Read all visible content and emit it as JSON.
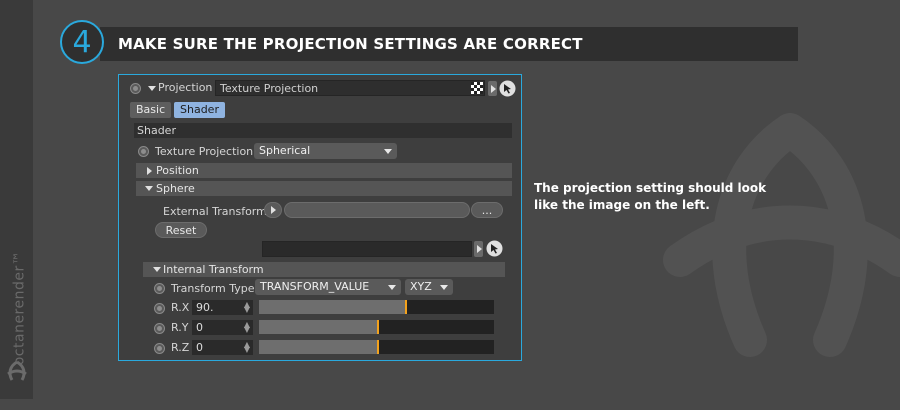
{
  "brand": {
    "name": "octanerender™"
  },
  "step": {
    "number": "4",
    "title": "MAKE SURE THE PROJECTION SETTINGS ARE CORRECT"
  },
  "description": "The projection setting should look like the image on the left.",
  "panel": {
    "projection": {
      "label": "Projection",
      "value": "Texture Projection"
    },
    "tabs": [
      {
        "label": "Basic",
        "active": false
      },
      {
        "label": "Shader",
        "active": true
      }
    ],
    "shader_header": "Shader",
    "texture_projection": {
      "label": "Texture Projection",
      "value": "Spherical"
    },
    "position_label": "Position",
    "sphere_label": "Sphere",
    "external_transform": {
      "label": "External Transform",
      "button": "..."
    },
    "reset_label": "Reset",
    "internal_transform_label": "Internal Transform",
    "transform_type": {
      "label": "Transform Type",
      "value": "TRANSFORM_VALUE",
      "order": "XYZ"
    },
    "rotations": [
      {
        "label": "R.X",
        "value": "90.",
        "fill": 0.62
      },
      {
        "label": "R.Y",
        "value": "0",
        "fill": 0.5
      },
      {
        "label": "R.Z",
        "value": "0",
        "fill": 0.5
      }
    ]
  },
  "colors": {
    "accent": "#2aa9dd",
    "marker": "#f3a21d",
    "active_tab": "#8fb3e0"
  }
}
